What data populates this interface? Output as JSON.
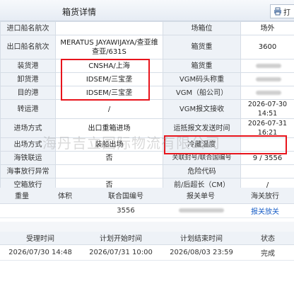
{
  "header": {
    "title": "箱货详情",
    "print_label": "打"
  },
  "details": [
    [
      "进口船名航次",
      "",
      "场箱位",
      "场外"
    ],
    [
      "出口船名航次",
      "MERATUS JAYAWIJAYA/查亚维查亚/631S",
      "箱货重",
      "3600"
    ],
    [
      "装货港",
      "CNSHA/上海",
      "箱货重",
      ""
    ],
    [
      "卸货港",
      "IDSEM/三宝垄",
      "VGM码头称重",
      ""
    ],
    [
      "目的港",
      "IDSEM/三宝垄",
      "VGM（船公司）",
      ""
    ],
    [
      "转运港",
      "/",
      "VGM报文接收",
      "2026-07-30 14:51"
    ],
    [
      "进场方式",
      "出口重箱进场",
      "运抵报文发送时间",
      "2026-07-31 16:21"
    ],
    [
      "出场方式",
      "装船出场",
      "冷藏温度",
      ""
    ],
    [
      "海铁联运",
      "否",
      "关联封号/联合国编号",
      "9 / 3556"
    ],
    [
      "海事放行异常",
      "",
      "危险代码",
      ""
    ],
    [
      "空箱放行",
      "否",
      "前/后超长（CM）",
      "/"
    ]
  ],
  "watermark": "海丹吉立国际物流有限公司",
  "containers": {
    "headers": [
      "重量",
      "体积",
      "联合国编号",
      "报关单号",
      "海关放行"
    ],
    "rows": [
      [
        "",
        "",
        "3556",
        "",
        "报关放关"
      ]
    ]
  },
  "tasks": {
    "headers": [
      "受理时间",
      "计划开始时间",
      "计划结束时间",
      "状态"
    ],
    "rows": [
      [
        "2026/07/30 14:48",
        "2026/07/31 10:00",
        "2026/08/03 23:59",
        "完成"
      ]
    ]
  },
  "colors": {
    "highlight": "#e8141c",
    "link": "#1a5fc7",
    "label_bg": "#eef2f7"
  }
}
